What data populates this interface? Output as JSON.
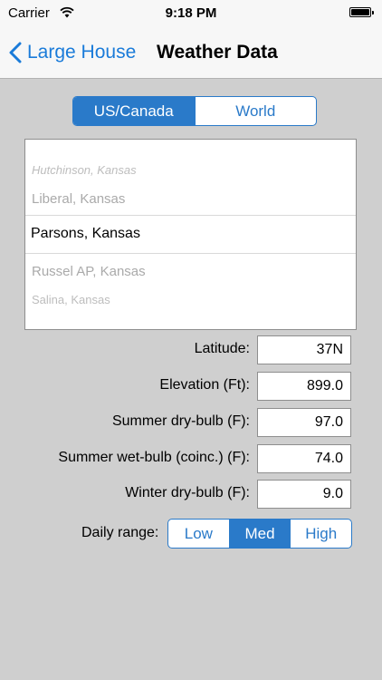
{
  "status_bar": {
    "carrier": "Carrier",
    "time": "9:18 PM"
  },
  "nav": {
    "back_label": "Large House",
    "title": "Weather Data",
    "accent_color": "#1a7bd9"
  },
  "region": {
    "options": [
      "US/Canada",
      "World"
    ],
    "selected": "US/Canada"
  },
  "picker": {
    "rows": [
      "Hutchinson, Kansas",
      "Liberal, Kansas",
      "Parsons, Kansas",
      "Russel AP, Kansas",
      "Salina, Kansas"
    ],
    "selected": "Parsons, Kansas"
  },
  "fields": {
    "latitude": {
      "label": "Latitude:",
      "value": "37N"
    },
    "elevation": {
      "label": "Elevation (Ft):",
      "value": "899.0"
    },
    "summer_dry": {
      "label": "Summer dry-bulb (F):",
      "value": "97.0"
    },
    "summer_wet": {
      "label": "Summer wet-bulb (coinc.) (F):",
      "value": "74.0"
    },
    "winter_dry": {
      "label": "Winter dry-bulb (F):",
      "value": "9.0"
    }
  },
  "daily_range": {
    "label": "Daily range:",
    "options": [
      "Low",
      "Med",
      "High"
    ],
    "selected": "Med"
  }
}
